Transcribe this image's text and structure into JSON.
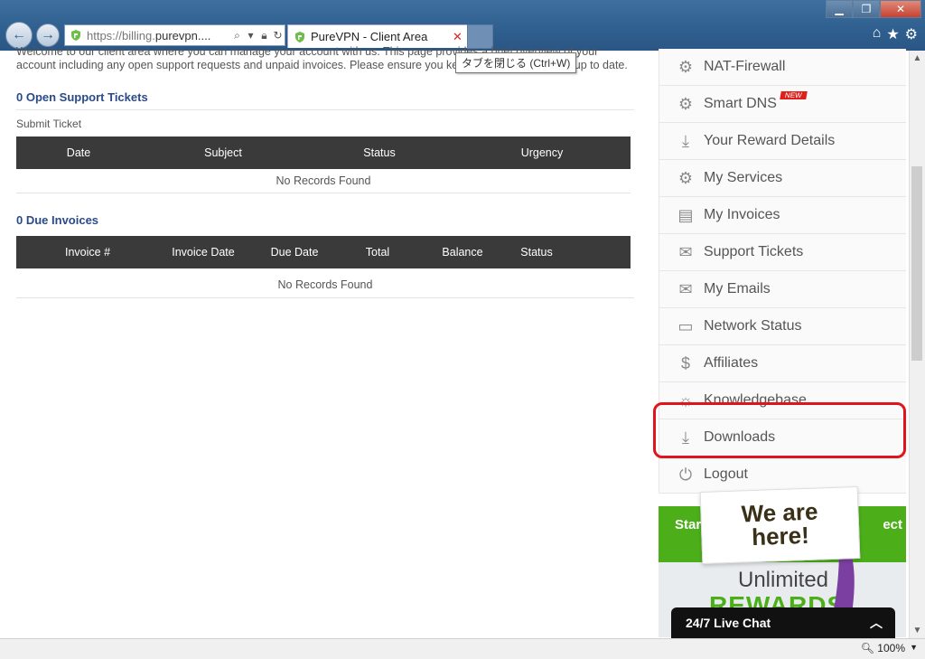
{
  "browser": {
    "url_prefix": "https://billing.",
    "url_domain": "purevpn....",
    "tab_title": "PureVPN - Client Area",
    "tooltip": "タブを閉じる (Ctrl+W)",
    "zoom": "100%"
  },
  "main": {
    "intro": "Welcome to our client area where you can manage your account with us. This page provides a brief overview of your account including any open support requests and unpaid invoices. Please ensure you keep your contact details up to date.",
    "tickets": {
      "title": "0 Open Support Tickets",
      "submit": "Submit Ticket",
      "columns": [
        "Date",
        "Subject",
        "Status",
        "Urgency"
      ],
      "empty": "No Records Found"
    },
    "invoices": {
      "title": "0 Due Invoices",
      "columns": [
        "Invoice #",
        "Invoice Date",
        "Due Date",
        "Total",
        "Balance",
        "Status"
      ],
      "empty": "No Records Found"
    }
  },
  "sidebar": {
    "items": [
      {
        "label": "NAT-Firewall",
        "icon": "gears-icon"
      },
      {
        "label": "Smart DNS",
        "icon": "gears-icon",
        "badge": "NEW"
      },
      {
        "label": "Your Reward Details",
        "icon": "download-icon"
      },
      {
        "label": "My Services",
        "icon": "gears-icon"
      },
      {
        "label": "My Invoices",
        "icon": "invoice-icon"
      },
      {
        "label": "Support Tickets",
        "icon": "envelope-icon"
      },
      {
        "label": "My Emails",
        "icon": "envelope-icon"
      },
      {
        "label": "Network Status",
        "icon": "monitor-icon"
      },
      {
        "label": "Affiliates",
        "icon": "affiliate-icon"
      },
      {
        "label": "Knowledgebase",
        "icon": "lightbulb-icon"
      },
      {
        "label": "Downloads",
        "icon": "download-icon"
      },
      {
        "label": "Logout",
        "icon": "power-icon"
      }
    ]
  },
  "promo": {
    "green_left": "Star",
    "green_right": "ect",
    "sign_line1": "We are",
    "sign_line2": "here!",
    "unlimited": "Unlimited",
    "rewards": "REWARDS"
  },
  "livechat": {
    "label": "24/7 Live Chat"
  },
  "colors": {
    "accent": "#2a4a8a",
    "highlight": "#e0141c",
    "promo_green": "#4caf1a"
  }
}
